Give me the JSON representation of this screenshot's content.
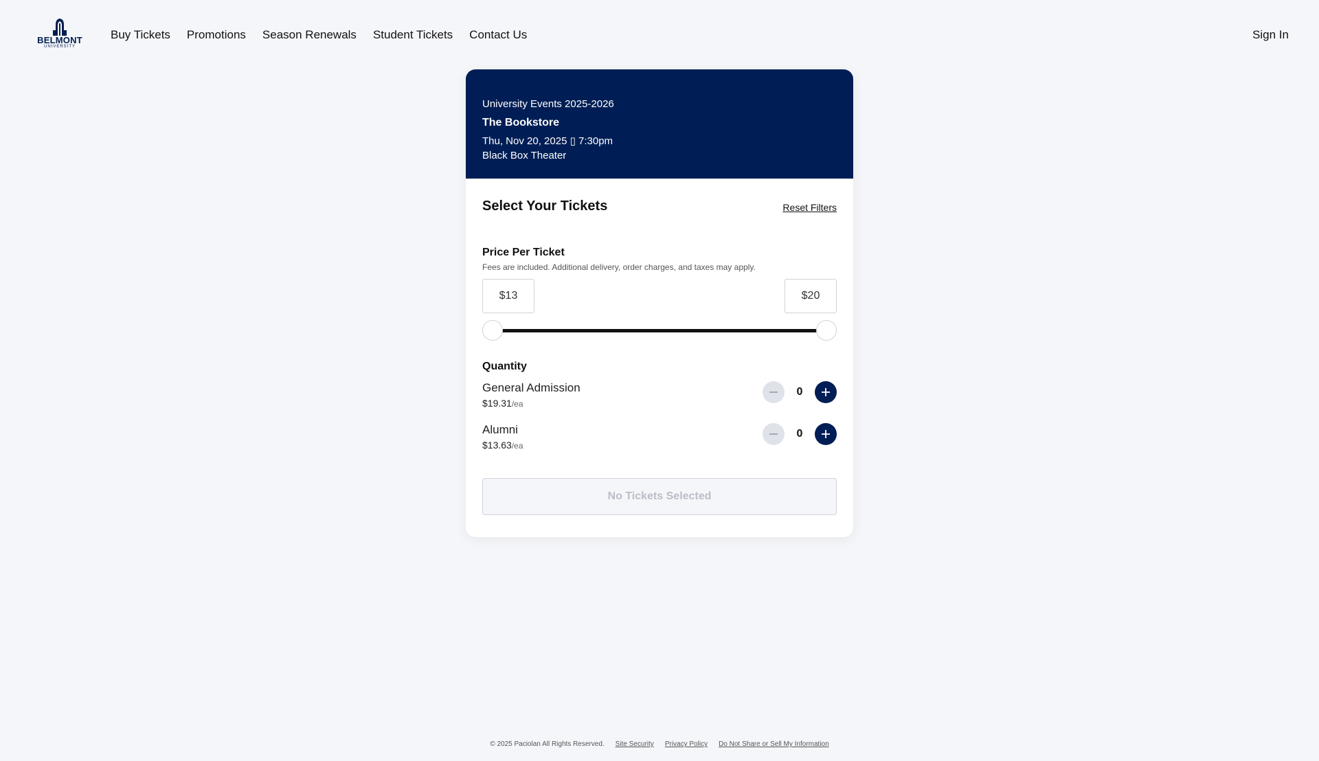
{
  "header": {
    "logo_text": "BELMONT",
    "logo_sub": "UNIVERSITY",
    "nav": [
      "Buy Tickets",
      "Promotions",
      "Season Renewals",
      "Student Tickets",
      "Contact Us"
    ],
    "sign_in": "Sign In"
  },
  "event": {
    "series": "University Events 2025-2026",
    "title": "The Bookstore",
    "datetime": "Thu, Nov 20, 2025 ▯ 7:30pm",
    "venue": "Black Box Theater"
  },
  "tickets": {
    "title": "Select Your Tickets",
    "reset": "Reset Filters",
    "price_label": "Price Per Ticket",
    "fees_note": "Fees are included. Additional delivery, order charges, and taxes may apply.",
    "price_min": "$13",
    "price_max": "$20",
    "quantity_label": "Quantity",
    "types": [
      {
        "name": "General Admission",
        "price": "$19.31",
        "unit": "/ea",
        "count": "0"
      },
      {
        "name": "Alumni",
        "price": "$13.63",
        "unit": "/ea",
        "count": "0"
      }
    ],
    "cta": "No Tickets Selected"
  },
  "footer": {
    "copyright": "© 2025 Paciolan All Rights Reserved.",
    "links": [
      "Site Security",
      "Privacy Policy",
      "Do Not Share or Sell My Information"
    ]
  },
  "colors": {
    "brand_navy": "#001e55",
    "page_bg": "#f5f6f9"
  }
}
